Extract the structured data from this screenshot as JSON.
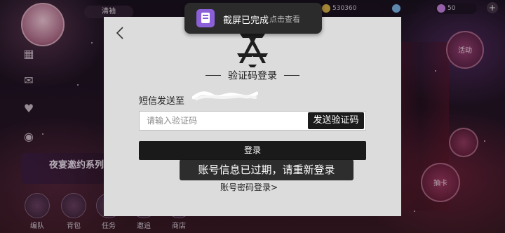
{
  "toast": {
    "icon": "screenshot-doc-icon",
    "title": "截屏已完成",
    "action": "点击查看"
  },
  "login_modal": {
    "title": "验证码登录",
    "sms_label": "短信发送至",
    "phone_masked": "",
    "code_input": {
      "value": "",
      "placeholder": "请输入验证码"
    },
    "send_code_label": "发送验证码",
    "login_label": "登录",
    "password_login_link": "账号密码登录>"
  },
  "expired_notice": "账号信息已过期，请重新登录",
  "game_hud": {
    "player_name": "清袖",
    "currency_amount": "530360",
    "currency2_amount": "50",
    "side_menu": [
      "grid-icon",
      "mail-icon",
      "heart-icon",
      "balloon-icon",
      "hanger-icon"
    ],
    "event_banner_title": "夜宴邀约系列",
    "bottom_nav": [
      "编队",
      "背包",
      "任务",
      "邀追",
      "商店"
    ],
    "right_buttons": [
      "活动",
      "抽卡"
    ]
  },
  "colors": {
    "modal_bg": "#dcdcdc",
    "button_dark": "#1a1a1a",
    "toast_bg": "#2b2b2b",
    "toast_icon": "#8a5fd8"
  }
}
